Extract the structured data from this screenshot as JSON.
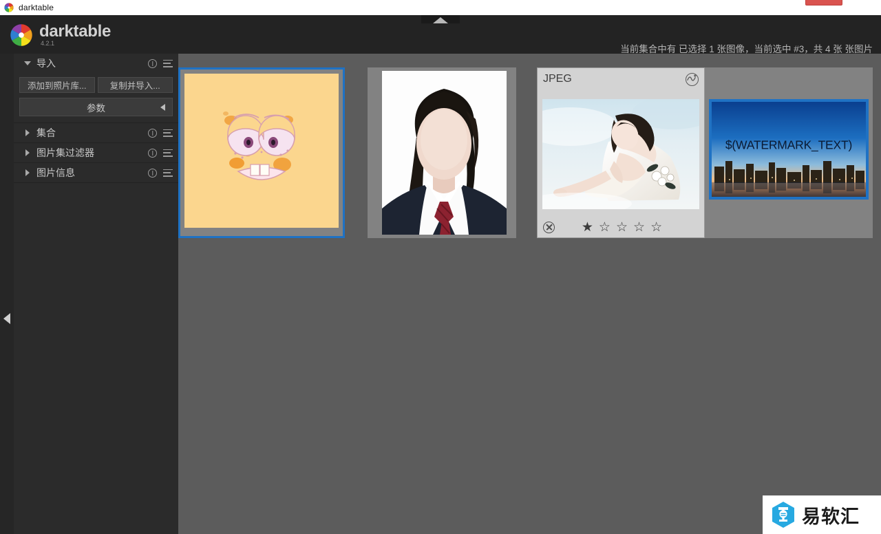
{
  "os_window": {
    "title": "darktable",
    "app_icon": "darktable-aperture-icon",
    "close_button": "window-close-button"
  },
  "app": {
    "brand_name": "darktable",
    "version": "4.2.1",
    "logo_icon": "darktable-aperture-logo",
    "status_text": "当前集合中有 已选择 1 张图像，当前选中 #3，共 4 张 张图片",
    "top_panel_collapse_icon": "chevron-up-icon",
    "left_panel_collapse_icon": "chevron-left-icon"
  },
  "sidebar": {
    "modules": [
      {
        "id": "import",
        "label": "导入",
        "expanded": true,
        "arrow": "triangle-down-icon",
        "info_icon": "info-icon",
        "menu_icon": "presets-menu-icon",
        "buttons": [
          {
            "id": "add-to-library",
            "label": "添加到照片库..."
          },
          {
            "id": "copy-and-import",
            "label": "复制并导入..."
          }
        ],
        "parameters": {
          "label": "参数",
          "arrow": "triangle-left-icon"
        }
      },
      {
        "id": "collections",
        "label": "集合",
        "expanded": false,
        "arrow": "triangle-right-icon",
        "info_icon": "info-icon",
        "menu_icon": "presets-menu-icon"
      },
      {
        "id": "collection-filters",
        "label": "图片集过滤器",
        "expanded": false,
        "arrow": "triangle-right-icon",
        "info_icon": "info-icon",
        "menu_icon": "presets-menu-icon"
      },
      {
        "id": "image-information",
        "label": "图片信息",
        "expanded": false,
        "arrow": "triangle-right-icon",
        "info_icon": "info-icon",
        "menu_icon": "presets-menu-icon"
      }
    ]
  },
  "lighttable": {
    "thumbnails": [
      {
        "id": "thumb-1",
        "name": "thumbnail-sponge-face",
        "selected": true,
        "hovered": false
      },
      {
        "id": "thumb-2",
        "name": "thumbnail-id-portrait",
        "selected": false,
        "hovered": false
      },
      {
        "id": "thumb-3",
        "name": "thumbnail-bride-photo",
        "selected": false,
        "hovered": true,
        "extension_label": "JPEG",
        "altered_icon": "altered-history-icon",
        "reject_icon": "reject-circle-x-icon",
        "rating": 1,
        "max_rating": 5,
        "star_filled": "★",
        "star_empty": "☆"
      },
      {
        "id": "thumb-4",
        "name": "thumbnail-watermark-city",
        "selected": true,
        "hovered": false,
        "watermark_text": "$(WATERMARK_TEXT)"
      }
    ]
  },
  "site_watermark": {
    "text": "易软汇",
    "logo_icon": "hexagon-brand-logo"
  },
  "colors": {
    "accent_blue": "#1f72c4",
    "header_bg": "#232323",
    "panel_bg": "#2b2b2b",
    "canvas_bg": "#5c5c5c",
    "cell_bg": "#828282",
    "hover_overlay": "#d3d3d3",
    "close_red": "#d9534f"
  }
}
